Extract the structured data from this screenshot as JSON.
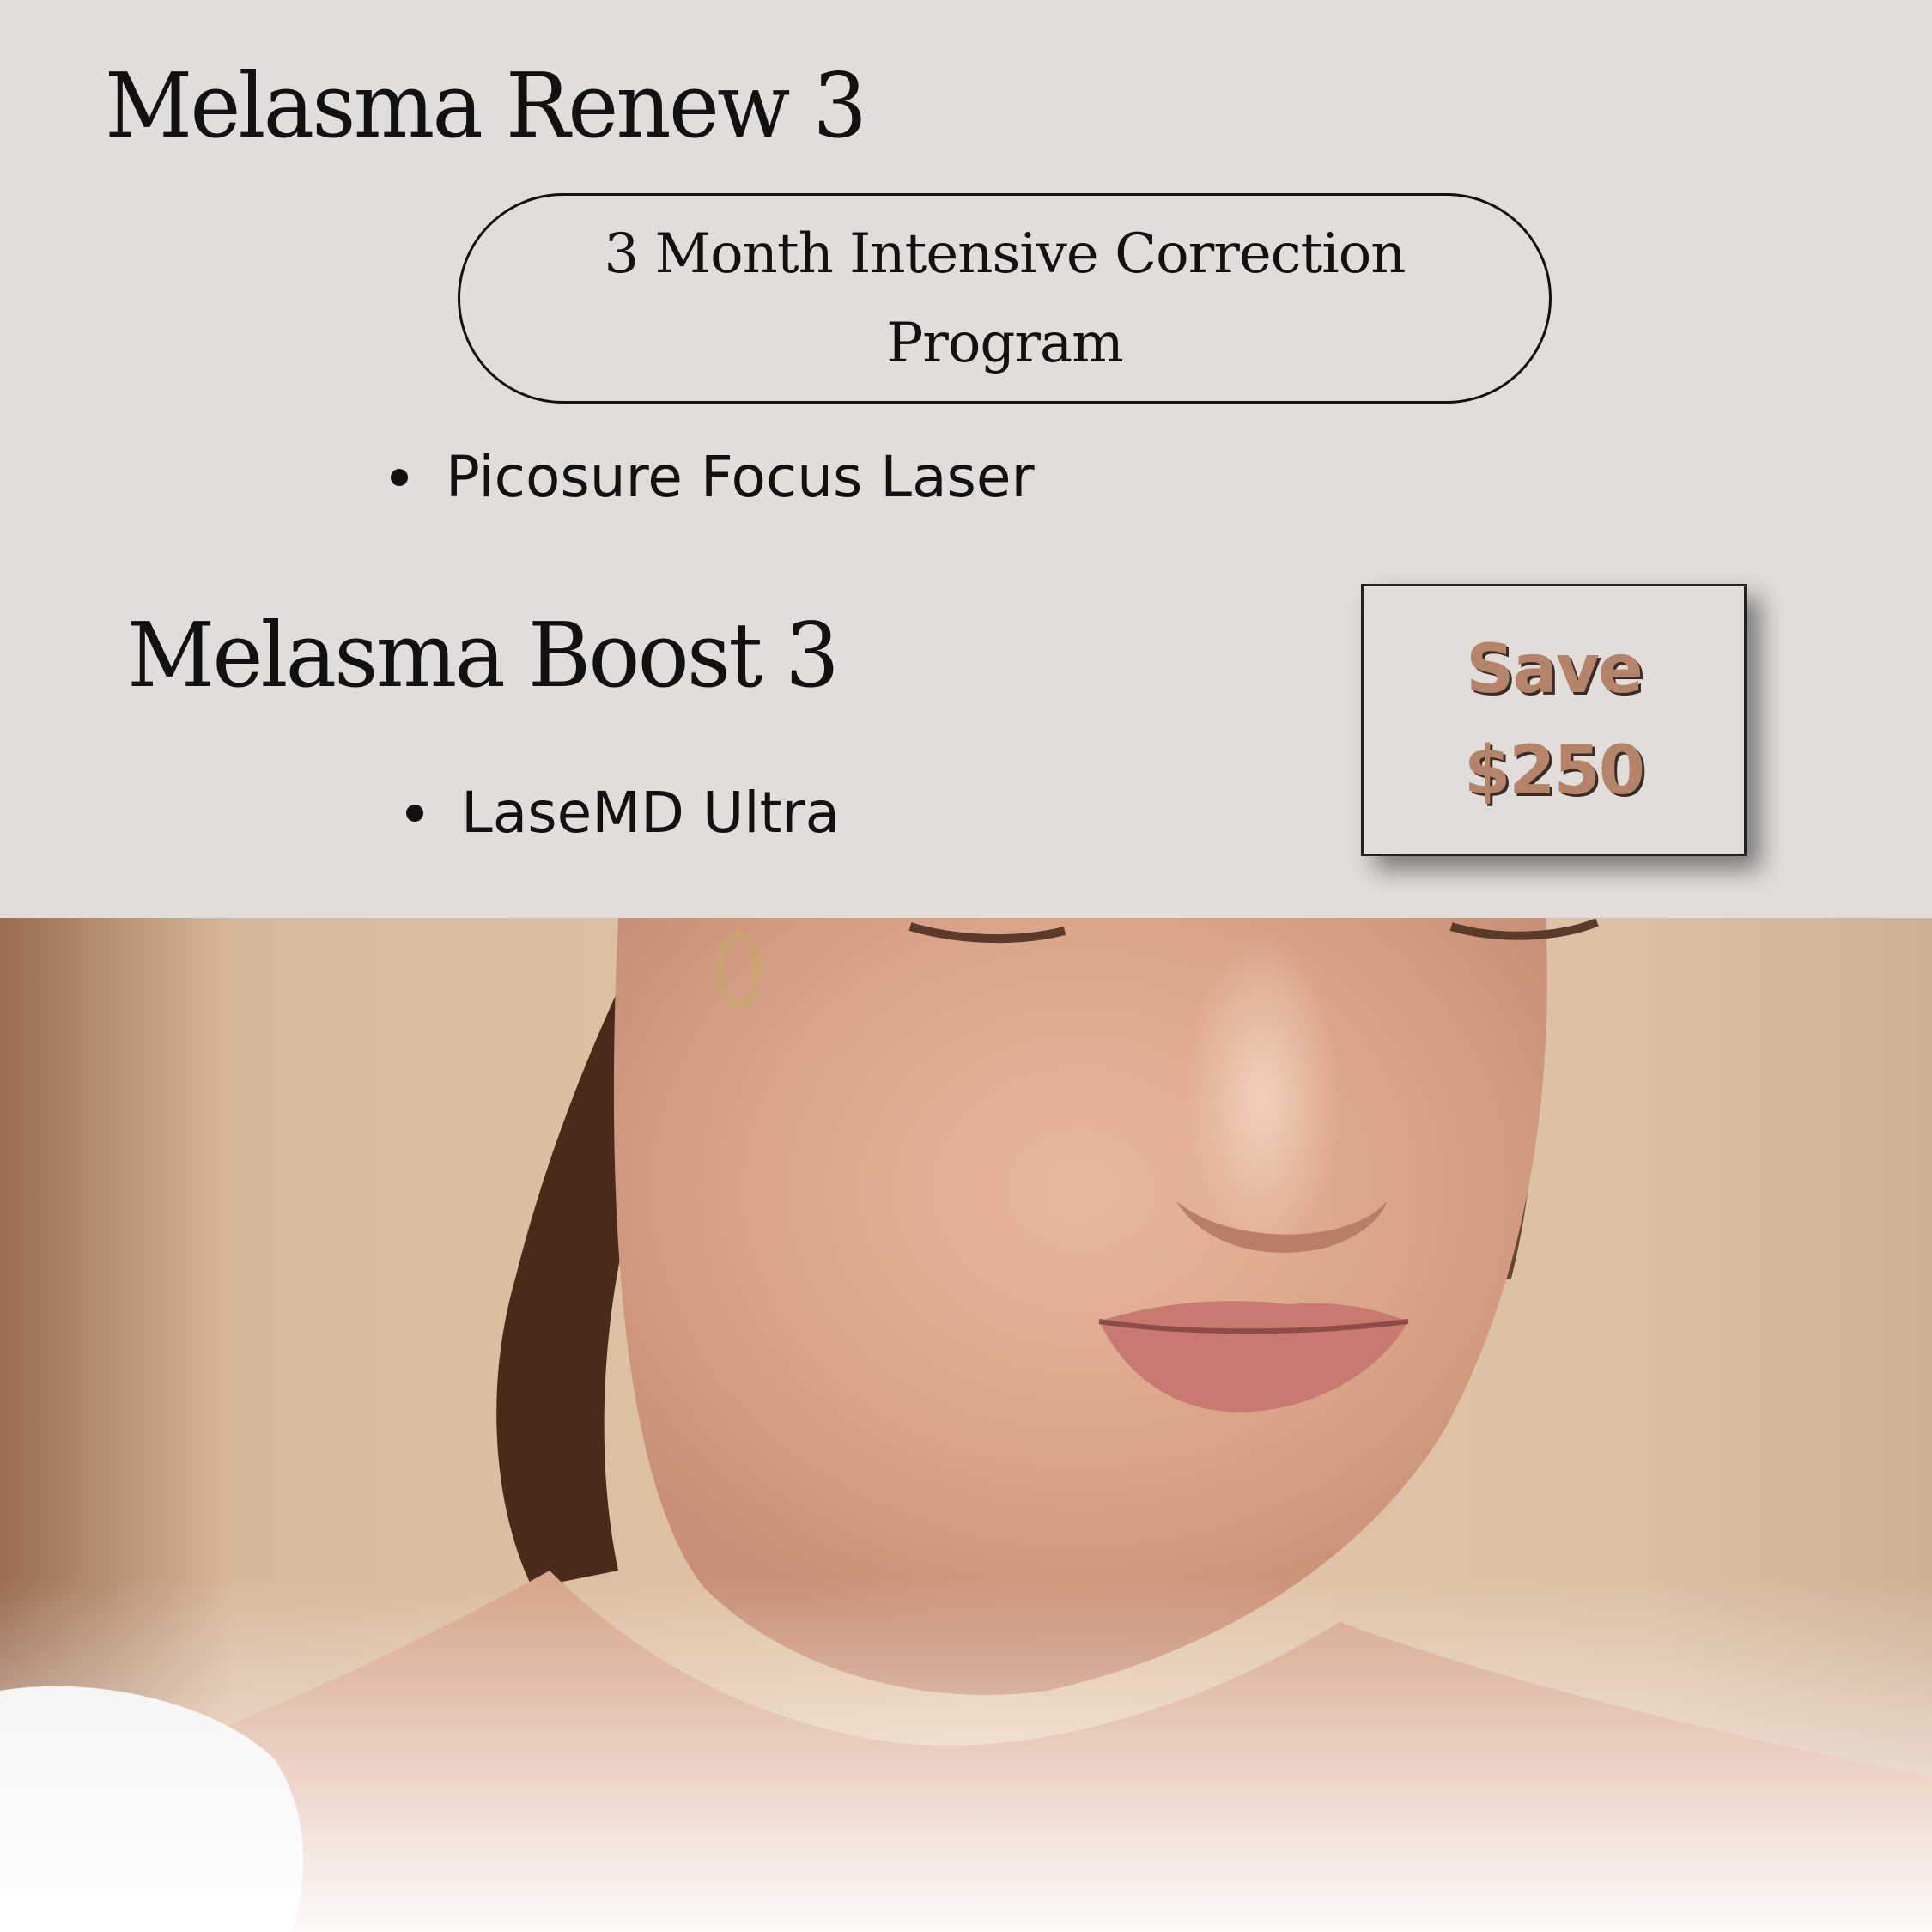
{
  "programs": [
    {
      "title": "Melasma Renew 3",
      "subtitle_line1": "3 Month Intensive Correction",
      "subtitle_line2": "Program",
      "items": [
        "Picosure Focus Laser"
      ]
    },
    {
      "title": "Melasma Boost 3",
      "items": [
        "LaseMD Ultra"
      ]
    }
  ],
  "savings_badge": {
    "line1": "Save",
    "line2": "$250"
  },
  "colors": {
    "background": "#e0ddda",
    "accent": "#b58468",
    "text": "#111111"
  }
}
